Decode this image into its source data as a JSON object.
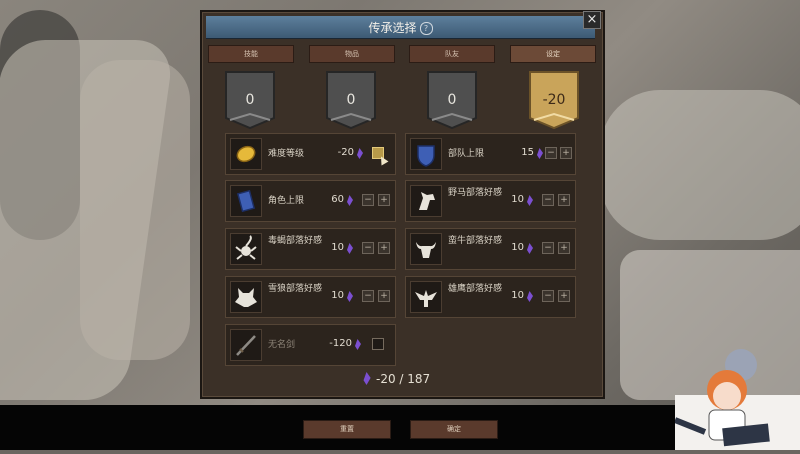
{
  "dialog": {
    "title": "传承选择",
    "help_icon": "?",
    "close_icon": "×"
  },
  "tabs": [
    {
      "label": "技能"
    },
    {
      "label": "物品"
    },
    {
      "label": "队友"
    },
    {
      "label": "设定"
    }
  ],
  "banners": [
    {
      "value": "0"
    },
    {
      "value": "0"
    },
    {
      "value": "0"
    },
    {
      "value": "-20"
    }
  ],
  "items": [
    {
      "label": "难度等级",
      "value": "-20",
      "icon": "gold-nugget-icon",
      "control": "checkbox-checked"
    },
    {
      "label": "部队上限",
      "value": "15",
      "icon": "blue-shield-icon",
      "control": "stepper"
    },
    {
      "label": "角色上限",
      "value": "60",
      "icon": "blue-card-icon",
      "control": "stepper"
    },
    {
      "label": "野马部落好感",
      "value": "10",
      "icon": "horse-head-icon",
      "control": "stepper"
    },
    {
      "label": "毒蝎部落好感",
      "value": "10",
      "icon": "scorpion-icon",
      "control": "stepper"
    },
    {
      "label": "蛮牛部落好感",
      "value": "10",
      "icon": "bull-head-icon",
      "control": "stepper"
    },
    {
      "label": "雪狼部落好感",
      "value": "10",
      "icon": "wolf-head-icon",
      "control": "stepper"
    },
    {
      "label": "雄鹰部落好感",
      "value": "10",
      "icon": "eagle-icon",
      "control": "stepper"
    },
    {
      "label": "无名剑",
      "value": "-120",
      "icon": "sword-icon",
      "control": "checkbox"
    }
  ],
  "stepper": {
    "minus": "−",
    "plus": "+"
  },
  "total": {
    "text": "-20 / 187"
  },
  "buttons": {
    "reset": "重置",
    "confirm": "确定"
  },
  "colors": {
    "gem": "#7b4fd0",
    "title_bar": "#4a6d8c",
    "panel": "#3b3027",
    "gold_banner": "#c9a45a"
  }
}
